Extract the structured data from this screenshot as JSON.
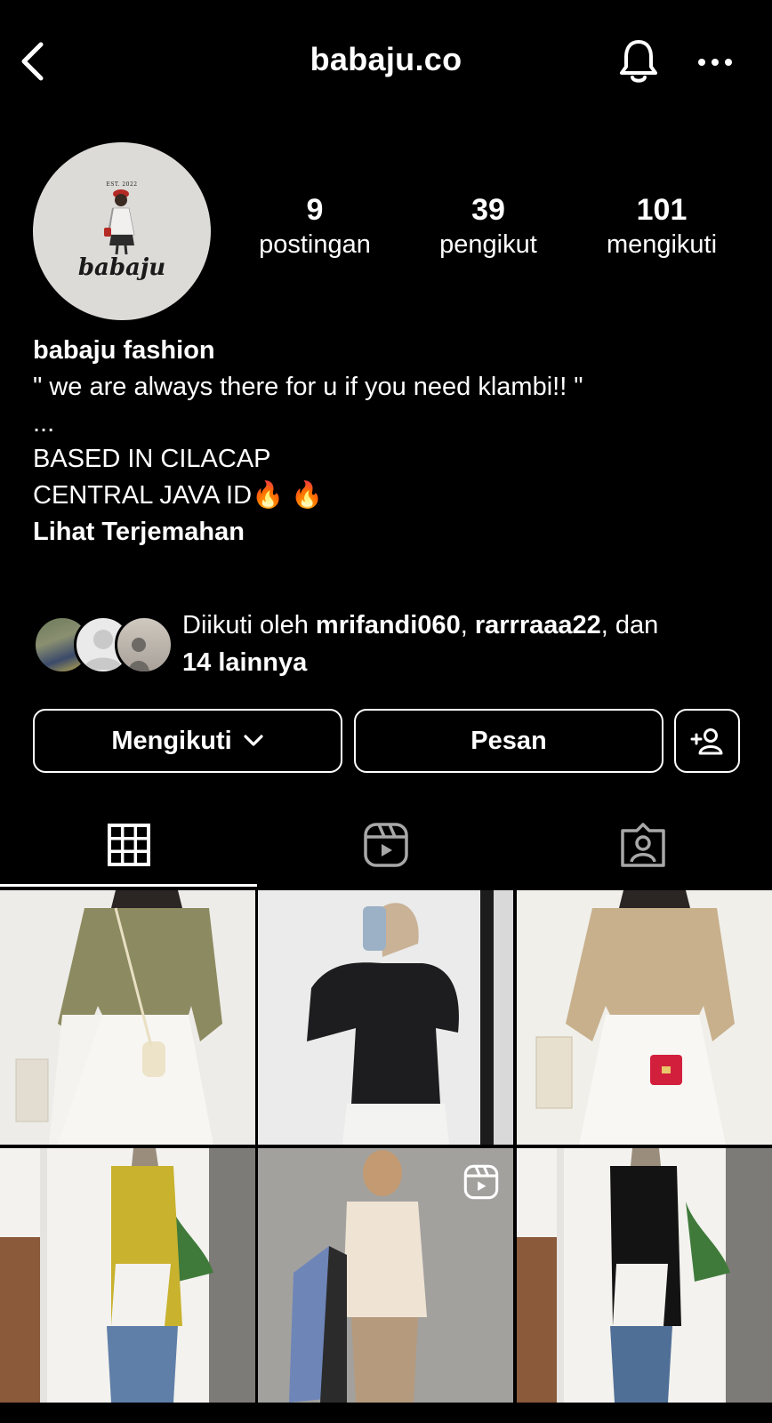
{
  "header": {
    "title": "babaju.co"
  },
  "profile": {
    "logo_est": "EST. 2022",
    "logo_name": "babaju",
    "stats": [
      {
        "value": "9",
        "label": "postingan"
      },
      {
        "value": "39",
        "label": "pengikut"
      },
      {
        "value": "101",
        "label": "mengikuti"
      }
    ],
    "name": "babaju fashion",
    "bio": [
      "\" we are always there for u if you need klambi!! \"",
      "...",
      "BASED IN CILACAP",
      "CENTRAL JAVA ID🔥 🔥"
    ],
    "translate": "Lihat Terjemahan"
  },
  "followed_by": {
    "prefix": "Diikuti oleh ",
    "user1": "mrifandi060",
    "sep": ", ",
    "user2": "rarrraaa22",
    "suffix": ", dan",
    "others": "14 lainnya"
  },
  "buttons": {
    "following": "Mengikuti",
    "message": "Pesan"
  },
  "tabs": [
    "grid-icon",
    "reels-icon",
    "tagged-icon"
  ],
  "grid": [
    {
      "kind": "post",
      "subject": "olive blouse white skirt"
    },
    {
      "kind": "post",
      "subject": "black blouse mirror selfie"
    },
    {
      "kind": "post",
      "subject": "beige blouse red bag"
    },
    {
      "kind": "post",
      "subject": "mustard long tunic"
    },
    {
      "kind": "reel",
      "subject": "cream blouse with hanging clothes"
    },
    {
      "kind": "post",
      "subject": "black long tunic"
    }
  ]
}
